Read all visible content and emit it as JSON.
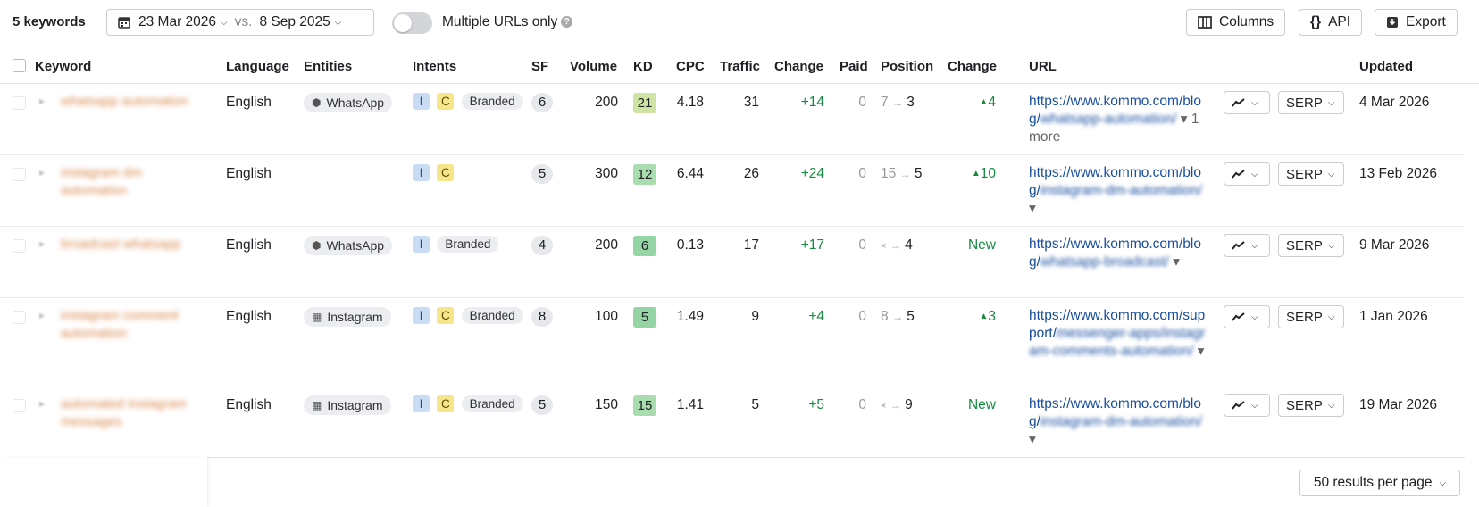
{
  "toolbar": {
    "keyword_count": "5 keywords",
    "date_current": "23 Mar 2026",
    "vs": "vs.",
    "date_compare": "8 Sep 2025",
    "toggle_label": "Multiple URLs only",
    "columns_label": "Columns",
    "api_label": "API",
    "export_label": "Export"
  },
  "headers": {
    "keyword": "Keyword",
    "language": "Language",
    "entities": "Entities",
    "intents": "Intents",
    "sf": "SF",
    "volume": "Volume",
    "kd": "KD",
    "cpc": "CPC",
    "traffic": "Traffic",
    "change": "Change",
    "paid": "Paid",
    "position": "Position",
    "pos_change": "Change",
    "url": "URL",
    "updated": "Updated"
  },
  "rows": [
    {
      "keyword": "whatsapp automation",
      "language": "English",
      "entity": "WhatsApp",
      "intent_i": "I",
      "intent_c": "C",
      "intent_b": "Branded",
      "sf": "6",
      "volume": "200",
      "kd": "21",
      "kd_color": "#cfe3a4",
      "cpc": "4.18",
      "traffic": "31",
      "change": "+14",
      "paid": "0",
      "pos_from": "7",
      "pos_to": "3",
      "pos_change": "▲4",
      "url_base": "https://www.kommo.com/blog/",
      "url_slug": "whatsapp-automation/",
      "url_more": "▾ 1 more",
      "serp": "SERP",
      "updated": "4 Mar 2026"
    },
    {
      "keyword": "instagram dm automation",
      "language": "English",
      "entity": "",
      "intent_i": "I",
      "intent_c": "C",
      "intent_b": "",
      "sf": "5",
      "volume": "300",
      "kd": "12",
      "kd_color": "#a9dcae",
      "cpc": "6.44",
      "traffic": "26",
      "change": "+24",
      "paid": "0",
      "pos_from": "15",
      "pos_to": "5",
      "pos_change": "▲10",
      "url_base": "https://www.kommo.com/blog/",
      "url_slug": "instagram-dm-automation/",
      "url_more": "▾",
      "serp": "SERP",
      "updated": "13 Feb 2026"
    },
    {
      "keyword": "broadcast whatsapp",
      "language": "English",
      "entity": "WhatsApp",
      "intent_i": "I",
      "intent_c": "",
      "intent_b": "Branded",
      "sf": "4",
      "volume": "200",
      "kd": "6",
      "kd_color": "#95d4a4",
      "cpc": "0.13",
      "traffic": "17",
      "change": "+17",
      "paid": "0",
      "pos_from": "×",
      "pos_to": "4",
      "pos_change": "New",
      "url_base": "https://www.kommo.com/blog/",
      "url_slug": "whatsapp-broadcast/",
      "url_more": "▾",
      "serp": "SERP",
      "updated": "9 Mar 2026"
    },
    {
      "keyword": "instagram comment automation",
      "language": "English",
      "entity": "Instagram",
      "intent_i": "I",
      "intent_c": "C",
      "intent_b": "Branded",
      "sf": "8",
      "volume": "100",
      "kd": "5",
      "kd_color": "#95d4a4",
      "cpc": "1.49",
      "traffic": "9",
      "change": "+4",
      "paid": "0",
      "pos_from": "8",
      "pos_to": "5",
      "pos_change": "▲3",
      "url_base": "https://www.kommo.com/support/",
      "url_slug": "messenger-apps/instagram-comments-automation/",
      "url_more": "▾",
      "serp": "SERP",
      "updated": "1 Jan 2026"
    },
    {
      "keyword": "automated instagram messages",
      "language": "English",
      "entity": "Instagram",
      "intent_i": "I",
      "intent_c": "C",
      "intent_b": "Branded",
      "sf": "5",
      "volume": "150",
      "kd": "15",
      "kd_color": "#a9dcae",
      "cpc": "1.41",
      "traffic": "5",
      "change": "+5",
      "paid": "0",
      "pos_from": "×",
      "pos_to": "9",
      "pos_change": "New",
      "url_base": "https://www.kommo.com/blog/",
      "url_slug": "instagram-dm-automation/",
      "url_more": "▾",
      "serp": "SERP",
      "updated": "19 Mar 2026"
    }
  ],
  "footer": {
    "per_page": "50 results per page"
  }
}
